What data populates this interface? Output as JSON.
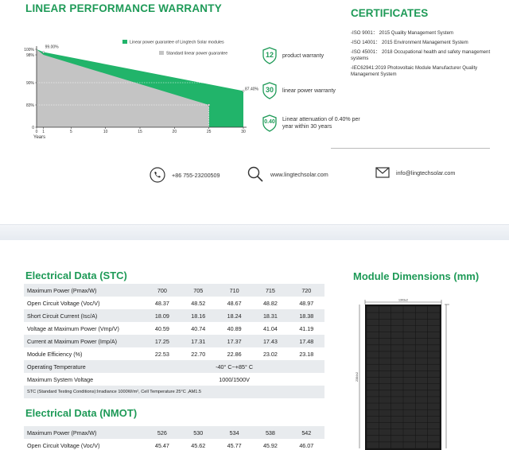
{
  "warranty": {
    "title": "LINEAR PERFORMANCE WARRANTY",
    "legend_green": "Linear power guarantee of Lingtech Solar modules",
    "legend_gray": "Standard linear power guarantee",
    "x_axis_caption": "Years",
    "start_label": "99.00%",
    "end_label": "87.40%",
    "colors": {
      "green": "#21b46a",
      "gray": "#c4c4c4"
    }
  },
  "chart_data": {
    "type": "area",
    "xlabel": "Years",
    "ylabel": "",
    "x_ticks": [
      "0",
      "1",
      "5",
      "10",
      "15",
      "20",
      "25",
      "30"
    ],
    "y_ticks": [
      "100%",
      "98%",
      "90%",
      "83%",
      "0"
    ],
    "series": [
      {
        "name": "Linear power guarantee of Lingtech Solar modules",
        "x": [
          1,
          30
        ],
        "y": [
          99.0,
          87.4
        ]
      },
      {
        "name": "Standard linear power guarantee",
        "x": [
          1,
          25
        ],
        "y": [
          98,
          83
        ]
      }
    ],
    "annotations": [
      "99.00%",
      "87.40%"
    ],
    "legend": "top-right"
  },
  "features": [
    {
      "icon": "shield-12-icon",
      "badge": "12",
      "text": "product warranty"
    },
    {
      "icon": "shield-30-icon",
      "badge": "30",
      "text": "linear power warranty"
    },
    {
      "icon": "shield-040-icon",
      "badge": "0.40",
      "text": "Linear attenuation of 0.40% per year within 30 years"
    }
  ],
  "certificates": {
    "title": "CERTIFICATES",
    "items": [
      "-ISO 9001： 2015 Quality Management System",
      "-ISO 14001： 2015 Environment Management System",
      "-ISO 45001： 2018 Occupational health and safety management systems",
      "-IEC62941:2019 Photovoltaic Module Manufacturer Quality Management System"
    ]
  },
  "contact": {
    "phone": "+86  755-23200509",
    "website": "www.lingtechsolar.com",
    "email": "info@lingtechsolar.com"
  },
  "stc": {
    "title": "Electrical Data (STC)",
    "rows": [
      {
        "label": "Maximum Power (Pmax/W)",
        "values": [
          "700",
          "705",
          "710",
          "715",
          "720"
        ]
      },
      {
        "label": "Open Circuit Voltage (Voc/V)",
        "values": [
          "48.37",
          "48.52",
          "48.67",
          "48.82",
          "48.97"
        ]
      },
      {
        "label": "Short Circuit Current (Isc/A)",
        "values": [
          "18.09",
          "18.16",
          "18.24",
          "18.31",
          "18.38"
        ]
      },
      {
        "label": "Voltage at Maximum Power (Vmp/V)",
        "values": [
          "40.59",
          "40.74",
          "40.89",
          "41.04",
          "41.19"
        ]
      },
      {
        "label": "Current at Maximum Power (Imp/A)",
        "values": [
          "17.25",
          "17.31",
          "17.37",
          "17.43",
          "17.48"
        ]
      },
      {
        "label": "Module Efficiency (%)",
        "values": [
          "22.53",
          "22.70",
          "22.86",
          "23.02",
          "23.18"
        ]
      }
    ],
    "operating_temperature_label": "Operating Temperature",
    "operating_temperature_value": "-40° C~+85° C",
    "max_system_voltage_label": "Maximum System Voltage",
    "max_system_voltage_value": "1000/1500V",
    "note": "STC (Standard Testing Conditions):Irradiance 1000W/m², Cell Temperature 25°C ,AM1.5"
  },
  "nmot": {
    "title": "Electrical Data (NMOT)",
    "rows": [
      {
        "label": "Maximum Power (Pmax/W)",
        "values": [
          "526",
          "530",
          "534",
          "538",
          "542"
        ]
      },
      {
        "label": "Open Circuit Voltage (Voc/V)",
        "values": [
          "45.47",
          "45.62",
          "45.77",
          "45.92",
          "46.07"
        ]
      }
    ]
  },
  "module": {
    "title": "Module Dimensions (mm)",
    "width_label": "1303±2",
    "height_label": "2384±2"
  }
}
